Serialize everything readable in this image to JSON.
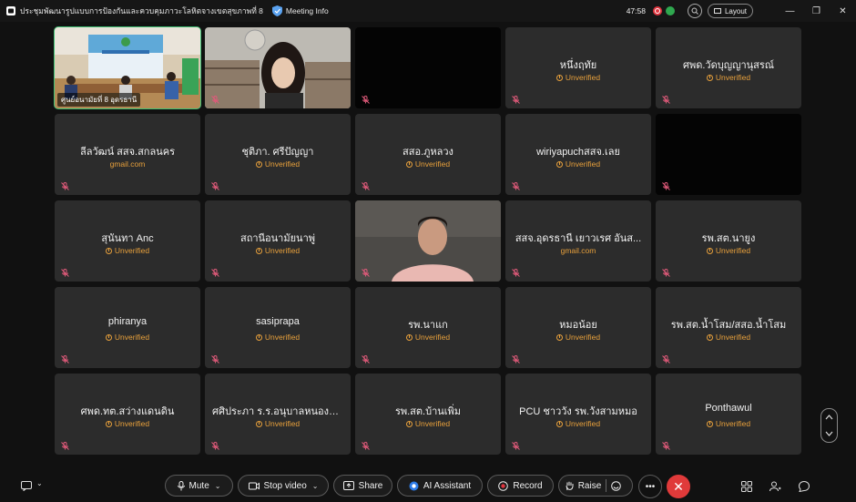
{
  "window": {
    "title": "ประชุมพัฒนารูปแบบการป้องกันและควบคุมภาวะโลหิตจางเขตสุขภาพที่ 8",
    "meeting_info": "Meeting Info",
    "timer": "47:58",
    "layout_label": "Layout",
    "minimize": "—",
    "restore": "❐",
    "close": "✕"
  },
  "participants": [
    {
      "name": "ศูนย์อนามัยที่ 8 อุดรธานี",
      "sub": "",
      "video": "office"
    },
    {
      "name": "",
      "sub": "",
      "video": "woman"
    },
    {
      "name": "",
      "sub": "",
      "video": "black"
    },
    {
      "name": "หนึ่งฤทัย",
      "sub": "Unverified",
      "video": ""
    },
    {
      "name": "ศพด.วัดบุญญานุสรณ์",
      "sub": "Unverified",
      "video": ""
    },
    {
      "name": "ลีลวัฒน์ สสจ.สกลนคร",
      "sub": "gmail.com",
      "video": ""
    },
    {
      "name": "ชุติภา. ศรีปัญญา",
      "sub": "Unverified",
      "video": ""
    },
    {
      "name": "สสอ.ภูหลวง",
      "sub": "Unverified",
      "video": ""
    },
    {
      "name": "wiriyapuchสสจ.เลย",
      "sub": "Unverified",
      "video": ""
    },
    {
      "name": "",
      "sub": "",
      "video": "black"
    },
    {
      "name": "สุนันทา Anc",
      "sub": "Unverified",
      "video": ""
    },
    {
      "name": "สถานีอนามัยนาพู่",
      "sub": "Unverified",
      "video": ""
    },
    {
      "name": "",
      "sub": "",
      "video": "man"
    },
    {
      "name": "สสจ.อุดรธานี เยาวเรศ อันส...",
      "sub": "gmail.com",
      "video": ""
    },
    {
      "name": "รพ.สต.นายูง",
      "sub": "Unverified",
      "video": ""
    },
    {
      "name": "phiranya",
      "sub": "Unverified",
      "video": ""
    },
    {
      "name": "sasiprapa",
      "sub": "Unverified",
      "video": ""
    },
    {
      "name": "รพ.นาแก",
      "sub": "Unverified",
      "video": ""
    },
    {
      "name": "หมอน้อย",
      "sub": "Unverified",
      "video": ""
    },
    {
      "name": "รพ.สต.น้ำโสม/สสอ.น้ำโสม",
      "sub": "Unverified",
      "video": ""
    },
    {
      "name": "ศพด.ทต.สว่างแดนดิน",
      "sub": "Unverified",
      "video": ""
    },
    {
      "name": "ศศิประภา ร.ร.อนุบาลหนองค...",
      "sub": "Unverified",
      "video": ""
    },
    {
      "name": "รพ.สต.บ้านเพิ่ม",
      "sub": "Unverified",
      "video": ""
    },
    {
      "name": "PCU ชาววัง รพ.วังสามหมอ",
      "sub": "Unverified",
      "video": ""
    },
    {
      "name": "Ponthawul",
      "sub": "Unverified",
      "video": ""
    }
  ],
  "toolbar": {
    "mute": "Mute",
    "stop_video": "Stop video",
    "share": "Share",
    "ai_assistant": "AI Assistant",
    "record": "Record",
    "raise": "Raise"
  },
  "colors": {
    "unverified": "#e7a03c",
    "end_button": "#e03a3a",
    "active_speaker": "#3fbf73"
  }
}
